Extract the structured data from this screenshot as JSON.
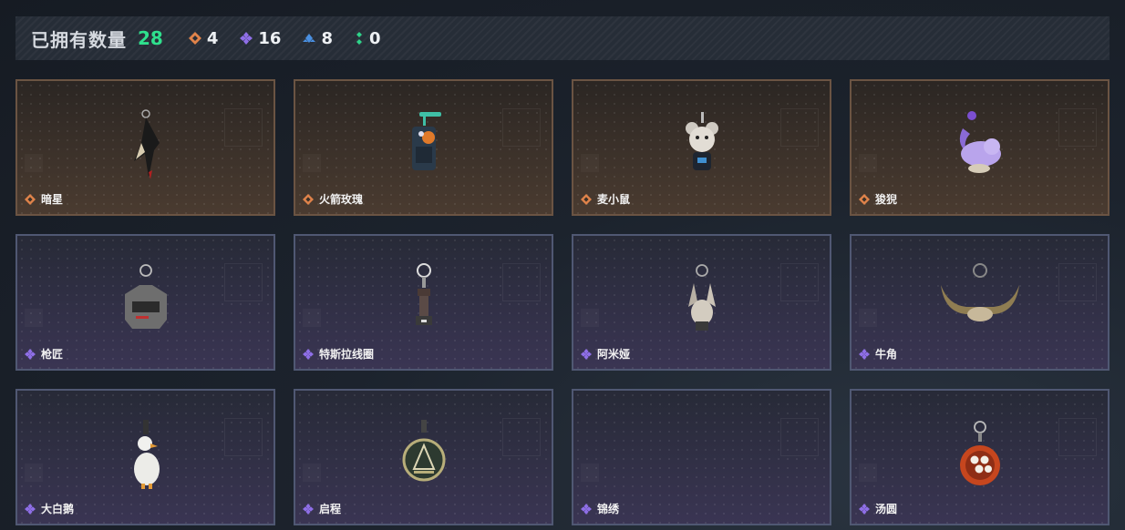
{
  "header": {
    "title": "已拥有数量",
    "total": "28",
    "stats": [
      {
        "icon": "orange-diamond-icon",
        "color": "#e0834a",
        "value": "4"
      },
      {
        "icon": "purple-clover-icon",
        "color": "#8f6fe8",
        "value": "16"
      },
      {
        "icon": "blue-triangle-icon",
        "color": "#4a90e2",
        "value": "8"
      },
      {
        "icon": "green-dots-icon",
        "color": "#2fd48a",
        "value": "0"
      }
    ]
  },
  "cards": [
    {
      "name": "暗星",
      "rarity": "orange",
      "item": "dark-star-charm"
    },
    {
      "name": "火箭玫瑰",
      "rarity": "orange",
      "item": "rocket-rose-charm"
    },
    {
      "name": "麦小鼠",
      "rarity": "orange",
      "item": "mouse-charm"
    },
    {
      "name": "狻猊",
      "rarity": "orange",
      "item": "suanni-charm"
    },
    {
      "name": "枪匠",
      "rarity": "purple",
      "item": "gunsmith-charm"
    },
    {
      "name": "特斯拉线圈",
      "rarity": "purple",
      "item": "tesla-coil-charm"
    },
    {
      "name": "阿米娅",
      "rarity": "purple",
      "item": "amiya-charm"
    },
    {
      "name": "牛角",
      "rarity": "purple",
      "item": "horn-charm"
    },
    {
      "name": "大白鹅",
      "rarity": "purple",
      "item": "goose-charm"
    },
    {
      "name": "启程",
      "rarity": "purple",
      "item": "departure-charm"
    },
    {
      "name": "锦绣",
      "rarity": "purple",
      "item": "empty"
    },
    {
      "name": "汤圆",
      "rarity": "purple",
      "item": "tangyuan-charm"
    }
  ]
}
